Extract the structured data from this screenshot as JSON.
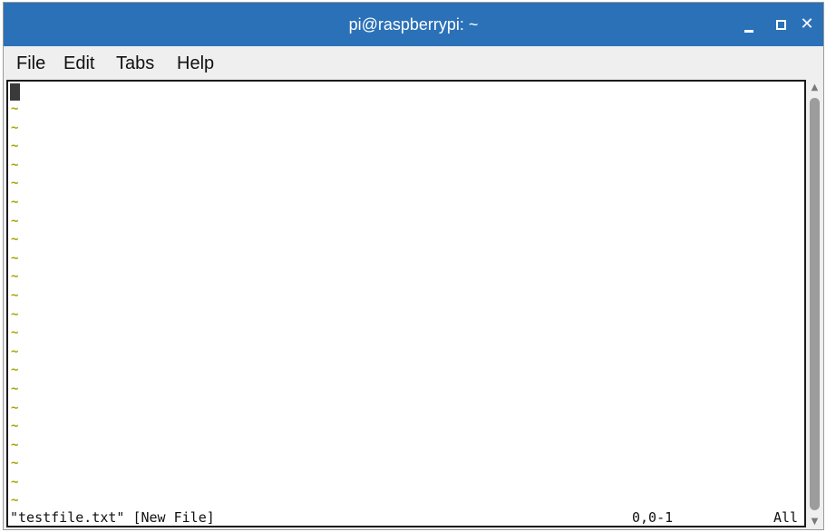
{
  "window": {
    "title": "pi@raspberrypi: ~",
    "controls": {
      "minimize": "_",
      "maximize": "□",
      "close": "✕"
    }
  },
  "menu": {
    "items": [
      {
        "label": "File"
      },
      {
        "label": "Edit"
      },
      {
        "label": "Tabs"
      },
      {
        "label": "Help"
      }
    ]
  },
  "editor": {
    "empty_line_marker": "~",
    "empty_line_count": 22,
    "status": {
      "message": "\"testfile.txt\" [New File]",
      "position": "0,0-1",
      "scroll": "All"
    }
  },
  "colors": {
    "titlebar": "#2b71b8",
    "tilde": "#a6a600"
  }
}
